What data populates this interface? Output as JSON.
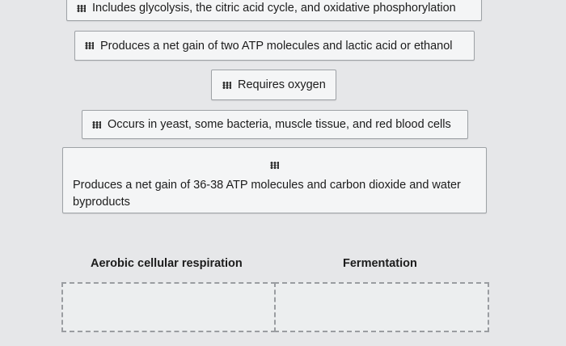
{
  "cards": [
    {
      "text": "Includes glycolysis, the citric acid cycle, and oxidative phosphorylation"
    },
    {
      "text": "Produces a net gain of two ATP molecules and lactic acid or ethanol"
    },
    {
      "text": "Requires oxygen"
    },
    {
      "text": "Occurs in yeast, some bacteria, muscle tissue, and red blood cells"
    },
    {
      "text": "Produces a net gain of 36-38 ATP molecules and carbon dioxide and water byproducts"
    }
  ],
  "drop_zones": [
    {
      "label": "Aerobic cellular respiration"
    },
    {
      "label": "Fermentation"
    }
  ]
}
